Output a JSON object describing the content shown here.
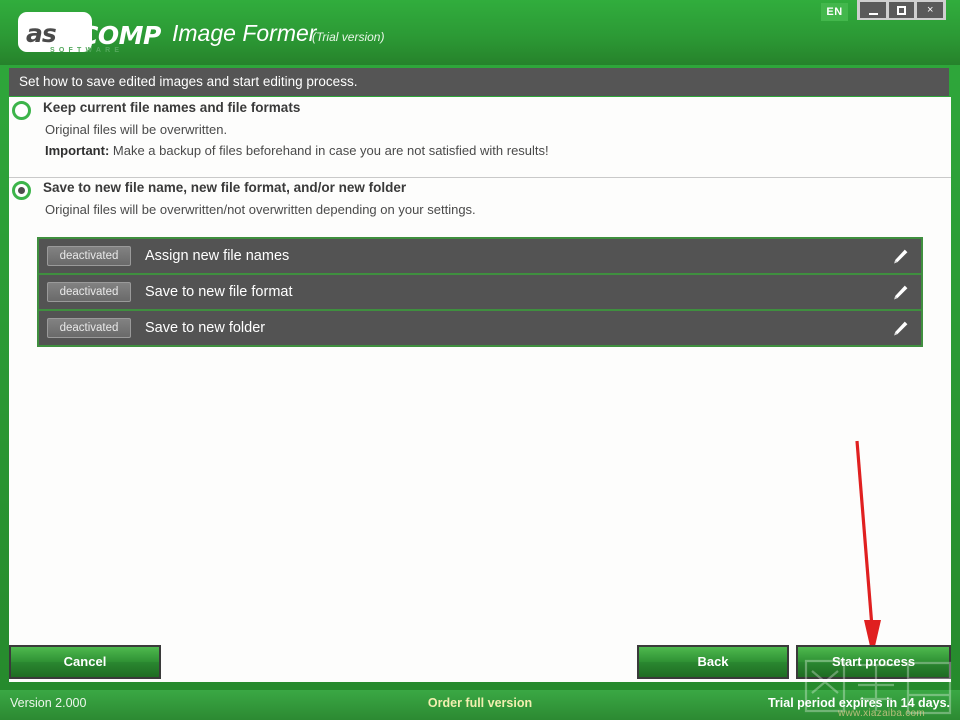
{
  "window": {
    "logo_as": "as",
    "logo_comp": "COMP",
    "logo_software": "SOFTWARE",
    "app_title": "Image Former",
    "trial_tag": "(Trial version)",
    "language_badge": "EN",
    "minimize_label": "Minimize",
    "maximize_label": "Maximize",
    "close_label": "×",
    "accent_green": "#2fa93c",
    "dark_gray": "#555555"
  },
  "subheader": {
    "text": "Set how to save edited images and start editing process."
  },
  "options": [
    {
      "title": "Keep current file names and file formats",
      "line1": "Original files will be overwritten.",
      "line2_bold": "Important:",
      "line2": " Make a backup of files beforehand in case you are not satisfied with results!",
      "selected": false
    },
    {
      "title": "Save to new file name, new file format, and/or new folder",
      "line1": "Original files will be overwritten/not overwritten depending on your settings.",
      "selected": true
    }
  ],
  "rows": [
    {
      "chip": "deactivated",
      "label": "Assign new file names",
      "edit_icon": "pencil-icon"
    },
    {
      "chip": "deactivated",
      "label": "Save to new file format",
      "edit_icon": "pencil-icon"
    },
    {
      "chip": "deactivated",
      "label": "Save to new folder",
      "edit_icon": "pencil-icon"
    }
  ],
  "buttons": {
    "cancel": "Cancel",
    "back": "Back",
    "start": "Start process"
  },
  "annotation": {
    "arrow_color": "#e02020",
    "points_to": "Start process"
  },
  "statusbar": {
    "version": "Version 2.000",
    "order": "Order full version",
    "trial": "Trial period expires in 14 days."
  },
  "watermark": {
    "url": "www.xiazaiba.com"
  }
}
